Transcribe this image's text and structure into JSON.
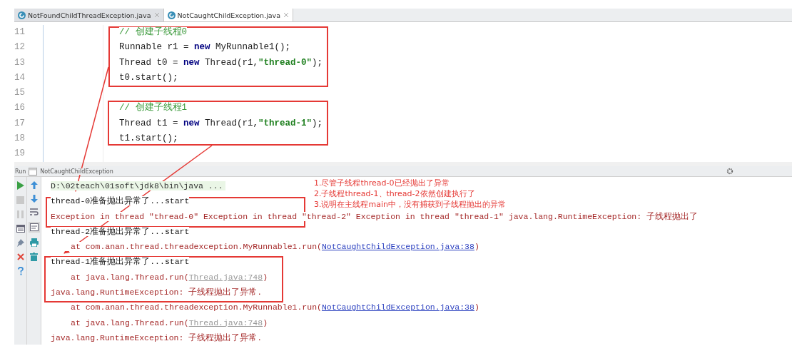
{
  "tabs": [
    {
      "label": "NotFoundChildThreadException.java",
      "selected": false
    },
    {
      "label": "NotCaughtChildException.java",
      "selected": true
    }
  ],
  "editor": {
    "lines": [
      {
        "number": "11",
        "tokens": [
          {
            "kind": "comment",
            "text": "// 创建子线程0"
          }
        ]
      },
      {
        "number": "12",
        "tokens": [
          {
            "kind": "plain",
            "text": "Runnable r1 = "
          },
          {
            "kind": "keyword",
            "text": "new"
          },
          {
            "kind": "plain",
            "text": " MyRunnable1();"
          }
        ]
      },
      {
        "number": "13",
        "tokens": [
          {
            "kind": "plain",
            "text": "Thread t0 = "
          },
          {
            "kind": "keyword",
            "text": "new"
          },
          {
            "kind": "plain",
            "text": " Thread(r1,"
          },
          {
            "kind": "string",
            "text": "\"thread-0\""
          },
          {
            "kind": "plain",
            "text": ");"
          }
        ]
      },
      {
        "number": "14",
        "tokens": [
          {
            "kind": "plain",
            "text": "t0.start();"
          }
        ]
      },
      {
        "number": "15"
      },
      {
        "number": "16",
        "tokens": [
          {
            "kind": "comment",
            "text": "// 创建子线程1"
          }
        ]
      },
      {
        "number": "17",
        "tokens": [
          {
            "kind": "plain",
            "text": "Thread t1 = "
          },
          {
            "kind": "keyword",
            "text": "new"
          },
          {
            "kind": "plain",
            "text": " Thread(r1,"
          },
          {
            "kind": "string",
            "text": "\"thread-1\""
          },
          {
            "kind": "plain",
            "text": ");"
          }
        ]
      },
      {
        "number": "18",
        "tokens": [
          {
            "kind": "plain",
            "text": "t1.start();"
          }
        ]
      },
      {
        "number": "19"
      }
    ]
  },
  "run_bar": {
    "label": "Run",
    "config": "NotCaughtChildException"
  },
  "console": {
    "lines": [
      {
        "kind": "command",
        "text": "D:\\02teach\\01soft\\jdk8\\bin\\java ..."
      },
      {
        "kind": "stdout",
        "text": "thread-0准备抛出异常了...start"
      },
      {
        "kind": "stderr",
        "text": "Exception in thread \"thread-0\" Exception in thread \"thread-2\" Exception in thread \"thread-1\" java.lang.RuntimeException: 子线程抛出了"
      },
      {
        "kind": "stdout",
        "text": "thread-2准备抛出异常了...start"
      },
      {
        "kind": "source_frame",
        "text": "at com.anan.thread.threadexception.MyRunnable1.run(",
        "link": "NotCaughtChildException.java:38",
        "suffix": ")"
      },
      {
        "kind": "stdout",
        "text": "thread-1准备抛出异常了...start"
      },
      {
        "kind": "library_frame",
        "text": "at java.lang.Thread.run(",
        "link": "Thread.java:748",
        "suffix": ")"
      },
      {
        "kind": "stderr",
        "text": "java.lang.RuntimeException: 子线程抛出了异常."
      },
      {
        "kind": "source_frame",
        "text": "at com.anan.thread.threadexception.MyRunnable1.run(",
        "link": "NotCaughtChildException.java:38",
        "suffix": ")"
      },
      {
        "kind": "library_frame",
        "text": "at java.lang.Thread.run(",
        "link": "Thread.java:748",
        "suffix": ")"
      },
      {
        "kind": "stderr",
        "text": "java.lang.RuntimeException: 子线程抛出了异常."
      }
    ]
  },
  "annotations": [
    "1.尽管子线程thread-0已经抛出了异常",
    "2.子线程thread-1、thread-2依然创建执行了",
    "3.说明在主线程main中，没有捕获到子线程抛出的异常"
  ]
}
